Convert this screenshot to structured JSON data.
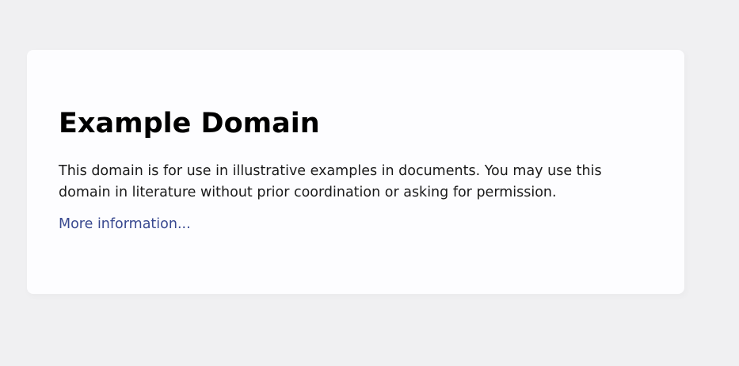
{
  "main": {
    "title": "Example Domain",
    "description": "This domain is for use in illustrative examples in documents. You may use this domain in literature without prior coordination or asking for permission.",
    "more_link_label": "More information..."
  },
  "colors": {
    "page_background": "#f0f0f2",
    "card_background": "#fdfdff",
    "link": "#38488f"
  }
}
